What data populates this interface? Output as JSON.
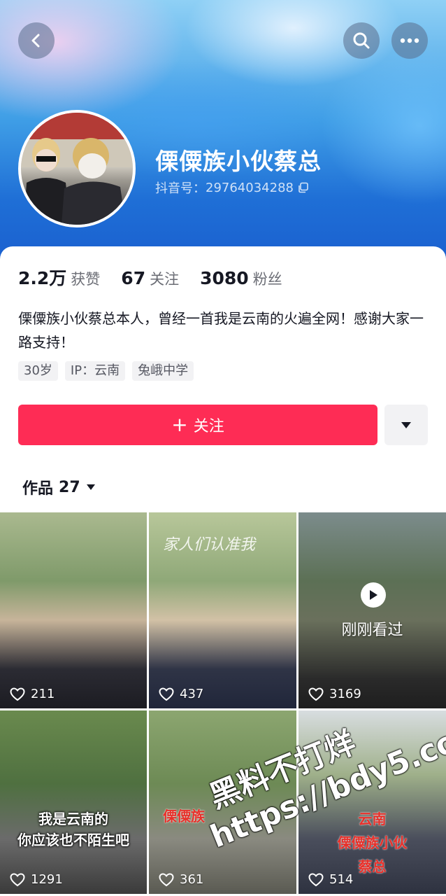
{
  "header": {
    "back_icon": "back-arrow-icon",
    "search_icon": "search-icon",
    "more_icon": "more-dots-icon"
  },
  "profile": {
    "name": "傈僳族小伙蔡总",
    "douyin_id_label": "抖音号：",
    "douyin_id": "29764034288",
    "copy_icon": "copy-icon"
  },
  "stats": [
    {
      "value": "2.2万",
      "label": "获赞"
    },
    {
      "value": "67",
      "label": "关注"
    },
    {
      "value": "3080",
      "label": "粉丝"
    }
  ],
  "bio": "傈僳族小伙蔡总本人，曾经一首我是云南的火遍全网！感谢大家一路支持！",
  "tags": [
    "30岁",
    "IP：云南",
    "兔峨中学"
  ],
  "actions": {
    "follow_label": "关注",
    "follow_icon": "plus-icon",
    "dropdown_icon": "caret-down-icon"
  },
  "works_tab": {
    "label": "作品",
    "count": "27"
  },
  "videos": [
    {
      "likes": "211"
    },
    {
      "likes": "437",
      "overlay_text": "家人们认准我"
    },
    {
      "likes": "3169",
      "recent_label": "刚刚看过"
    },
    {
      "likes": "1291",
      "caption_line1": "我是云南的",
      "caption_line2": "你应该也不陌生吧"
    },
    {
      "likes": "361",
      "caption": "傈僳族"
    },
    {
      "likes": "514",
      "caption_line1": "云南",
      "caption_line2": "傈僳族小伙",
      "caption_line3": "蔡总"
    }
  ],
  "watermark": {
    "line1": "黑料不打烊",
    "line2": "https://bdy5.co"
  },
  "colors": {
    "accent": "#fe2c55",
    "banner_blue": "#1f6fd6"
  }
}
